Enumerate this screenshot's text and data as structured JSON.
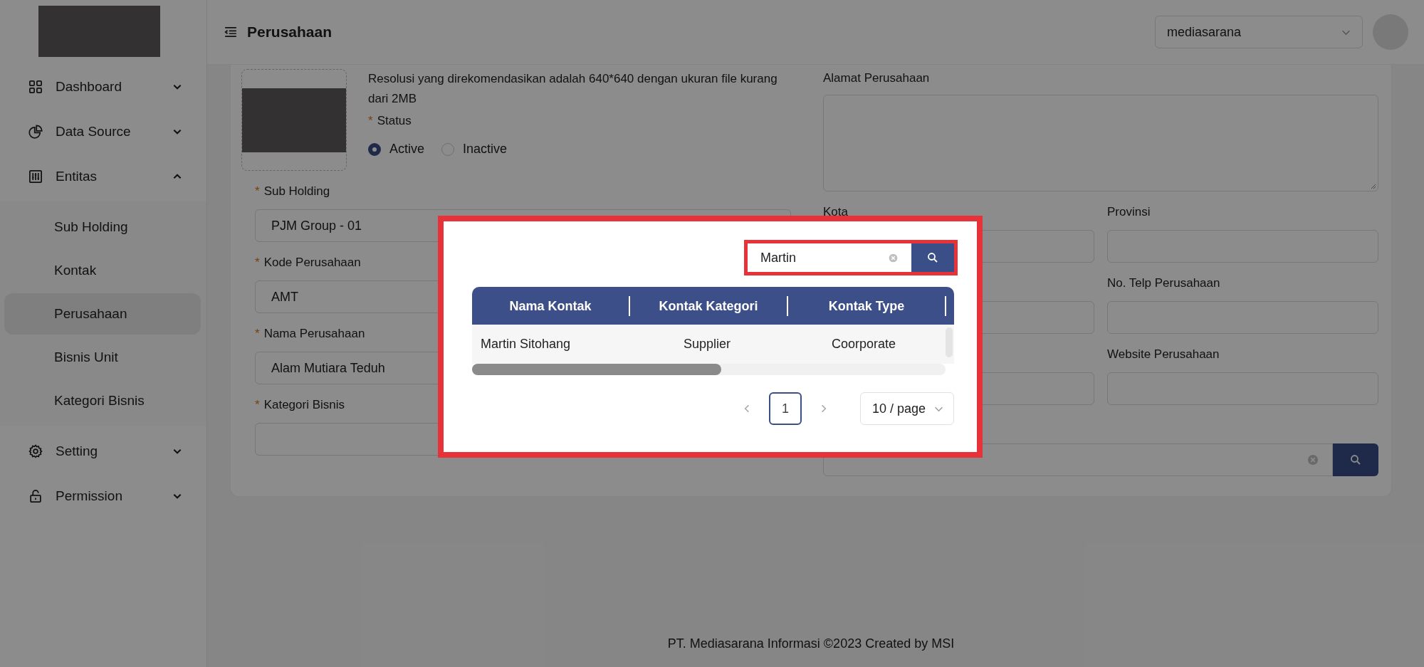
{
  "sidebar": {
    "items": [
      {
        "label": "Dashboard",
        "expanded": false
      },
      {
        "label": "Data Source",
        "expanded": false
      },
      {
        "label": "Entitas",
        "expanded": true,
        "children": [
          {
            "label": "Sub Holding",
            "selected": false
          },
          {
            "label": "Kontak",
            "selected": false
          },
          {
            "label": "Perusahaan",
            "selected": true
          },
          {
            "label": "Bisnis Unit",
            "selected": false
          },
          {
            "label": "Kategori Bisnis",
            "selected": false
          }
        ]
      },
      {
        "label": "Setting",
        "expanded": false
      },
      {
        "label": "Permission",
        "expanded": false
      }
    ]
  },
  "header": {
    "title": "Perusahaan",
    "company_select": {
      "value": "mediasarana"
    }
  },
  "form": {
    "upload_hint": "Resolusi yang direkomendasikan adalah 640*640 dengan ukuran file kurang dari 2MB",
    "status": {
      "label": "Status",
      "required_mark": "*",
      "options": [
        {
          "label": "Active",
          "selected": true
        },
        {
          "label": "Inactive",
          "selected": false
        }
      ]
    },
    "left_fields": [
      {
        "label": "Sub Holding",
        "required_mark": "*",
        "value": "PJM Group - 01"
      },
      {
        "label": "Kode Perusahaan",
        "required_mark": "*",
        "value": "AMT"
      },
      {
        "label": "Nama Perusahaan",
        "required_mark": "*",
        "value": "Alam Mutiara Teduh"
      },
      {
        "label": "Kategori Bisnis",
        "required_mark": "*"
      }
    ],
    "address": {
      "label": "Alamat Perusahaan"
    },
    "right_fields": [
      {
        "kind": "labeled",
        "label": "Kota"
      },
      {
        "kind": "labeled",
        "label": "Provinsi"
      },
      {
        "kind": "unlabeled"
      },
      {
        "kind": "labeled",
        "label": "No. Telp Perusahaan"
      },
      {
        "kind": "unlabeled"
      },
      {
        "kind": "labeled",
        "label": "Website Perusahaan"
      }
    ]
  },
  "modal": {
    "highlighted": true,
    "search": {
      "value": "Martin",
      "highlighted": true
    },
    "table": {
      "columns": [
        "Nama Kontak",
        "Kontak Kategori",
        "Kontak Type"
      ],
      "rows": [
        [
          "Martin Sitohang",
          "Supplier",
          "Coorporate"
        ]
      ]
    },
    "pagination": {
      "pages": [
        {
          "label": "1",
          "selected": true
        }
      ],
      "page_size": "10 / page"
    }
  },
  "footer": "PT. Mediasarana Informasi ©2023 Created by MSI"
}
